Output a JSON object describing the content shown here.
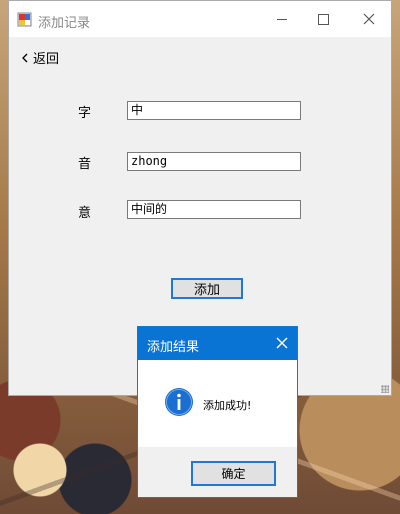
{
  "window": {
    "title": "添加记录",
    "back_label": "返回"
  },
  "form": {
    "char_label": "字",
    "char_value": "中",
    "pinyin_label": "音",
    "pinyin_value": "zhong",
    "meaning_label": "意",
    "meaning_value": "中间的",
    "add_button": "添加"
  },
  "dialog": {
    "title": "添加结果",
    "message": "添加成功!",
    "ok_button": "确定"
  },
  "colors": {
    "accent": "#0a74d4",
    "window_bg": "#f0f0f0"
  },
  "icons": [
    "app-icon",
    "minimize-icon",
    "maximize-icon",
    "close-icon",
    "back-chevron-icon",
    "info-icon",
    "dialog-close-icon",
    "resize-grip-icon"
  ]
}
